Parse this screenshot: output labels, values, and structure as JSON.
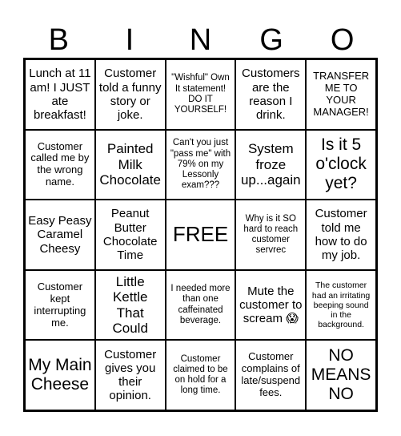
{
  "header": {
    "letters": [
      "B",
      "I",
      "N",
      "G",
      "O"
    ]
  },
  "cells": [
    [
      "Lunch at 11 am! I JUST ate breakfast!",
      "Customer told a funny story or joke.",
      "\"Wishful\" Own It statement! DO IT YOURSELF!",
      "Customers are the reason I drink.",
      "TRANSFER ME TO YOUR MANAGER!"
    ],
    [
      "Customer called me by the wrong name.",
      "Painted Milk Chocolate",
      "Can't you just \"pass me\" with 79% on my Lessonly exam???",
      "System froze up...again",
      "Is it 5 o'clock yet?"
    ],
    [
      "Easy Peasy Caramel Cheesy",
      "Peanut Butter Chocolate Time",
      "FREE",
      "Why is it SO hard to reach customer servrec",
      "Customer told me how to do my job."
    ],
    [
      "Customer kept interrupting me.",
      "Little Kettle That Could",
      "I needed more than one caffeinated beverage.",
      "Mute the customer to scream 😱",
      "The customer had an irritating beeping sound in the background."
    ],
    [
      "My Main Cheese",
      "Customer gives you their opinion.",
      "Customer claimed to be on hold for a long time.",
      "Customer complains of late/suspend fees.",
      "NO MEANS NO"
    ]
  ]
}
